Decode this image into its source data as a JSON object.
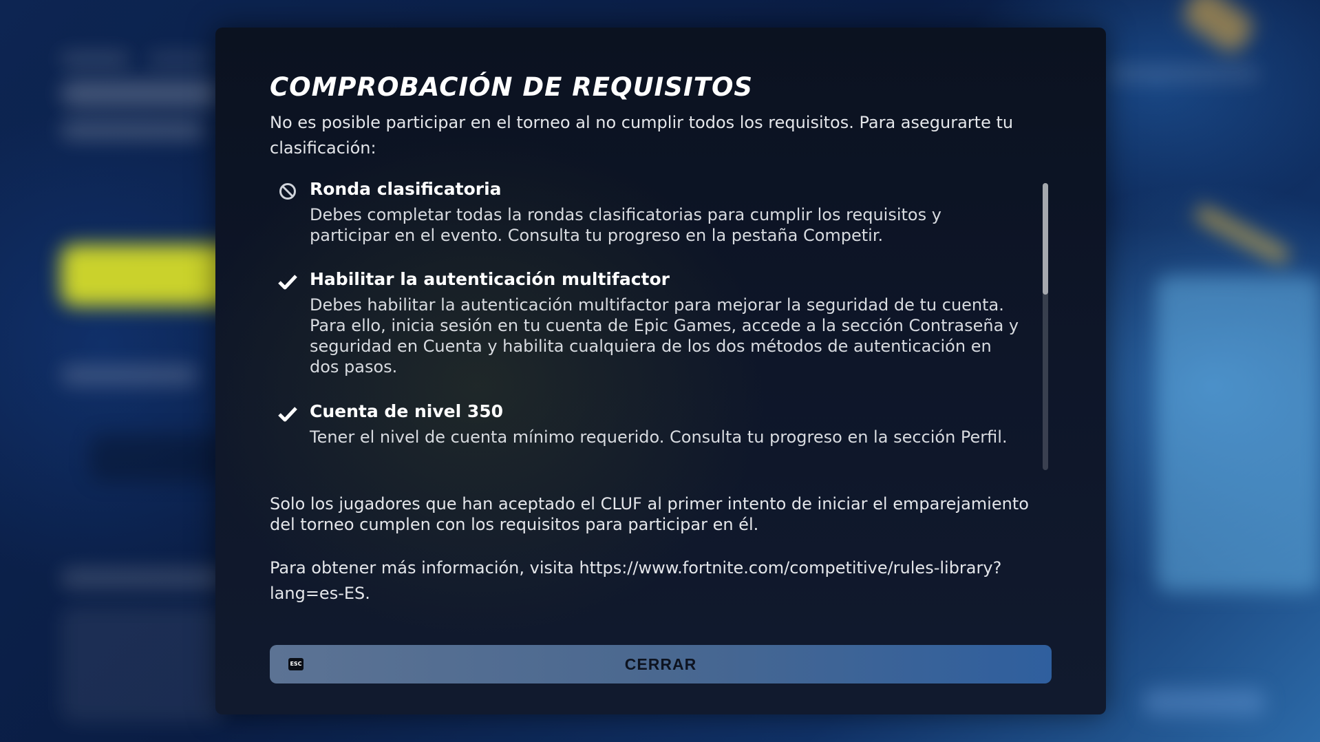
{
  "modal": {
    "title": "COMPROBACIÓN DE REQUISITOS",
    "intro": "No es posible participar en el torneo al no cumplir todos los requisitos. Para asegurarte tu clasificación:",
    "requirements": [
      {
        "name": "Ronda clasificatoria",
        "status": "not-met",
        "icon": "prohibited-icon",
        "description": "Debes completar todas la rondas clasificatorias para cumplir los requisitos y participar en el evento. Consulta tu progreso en la pestaña Competir."
      },
      {
        "name": "Habilitar la autenticación multifactor",
        "status": "met",
        "icon": "checkmark-icon",
        "description": "Debes habilitar la autenticación multifactor para mejorar la seguridad de tu cuenta. Para ello, inicia sesión en tu cuenta de Epic Games, accede a la sección Contraseña y seguridad en Cuenta y habilita cualquiera de los dos métodos de autenticación en dos pasos."
      },
      {
        "name": "Cuenta de nivel 350",
        "status": "met",
        "icon": "checkmark-icon",
        "description": "Tener el nivel de cuenta mínimo requerido. Consulta tu progreso en la sección Perfil."
      }
    ],
    "note_eula": "Solo los jugadores que han aceptado el CLUF al primer intento de iniciar el emparejamiento del torneo cumplen con los requisitos para participar en él.",
    "note_info": "Para obtener más información, visita https://www.fortnite.com/competitive/rules-library?lang=es-ES.",
    "close_button": {
      "key_hint": "ESC",
      "label": "CERRAR"
    }
  },
  "colors": {
    "modal_bg": "#0e1629",
    "button_start": "#5c7394",
    "button_end": "#2f5f9e",
    "text_primary": "#ffffff",
    "text_secondary": "#e4e6ea"
  }
}
